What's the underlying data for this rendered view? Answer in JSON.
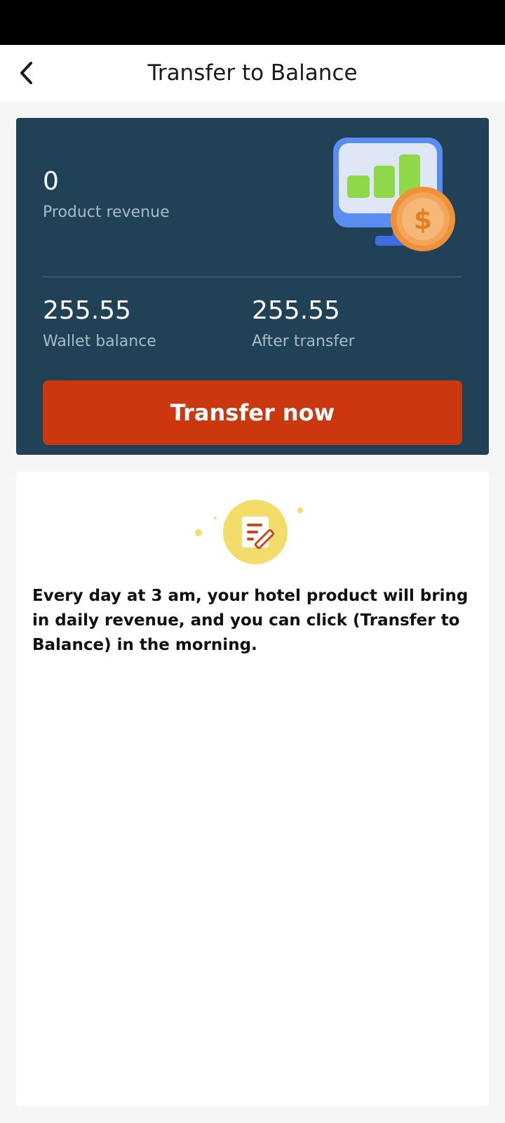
{
  "header": {
    "title": "Transfer to Balance",
    "back_icon": "chevron-left-icon"
  },
  "summary": {
    "product_revenue": {
      "value": "0",
      "label": "Product revenue"
    },
    "wallet_balance": {
      "value": "255.55",
      "label": "Wallet balance"
    },
    "after_transfer": {
      "value": "255.55",
      "label": "After transfer"
    },
    "button_label": "Transfer now",
    "illustration_icon": "monitor-chart-coin-icon"
  },
  "info": {
    "icon": "note-edit-icon",
    "text": "Every day at 3 am, your hotel product will bring in daily revenue, and you can click (Transfer to Balance) in the morning."
  },
  "colors": {
    "card_bg": "#214256",
    "button_bg": "#cb3810",
    "page_bg": "#f5f5f5",
    "label_muted": "#a9bac4",
    "note_circle": "#f4dc6b"
  }
}
